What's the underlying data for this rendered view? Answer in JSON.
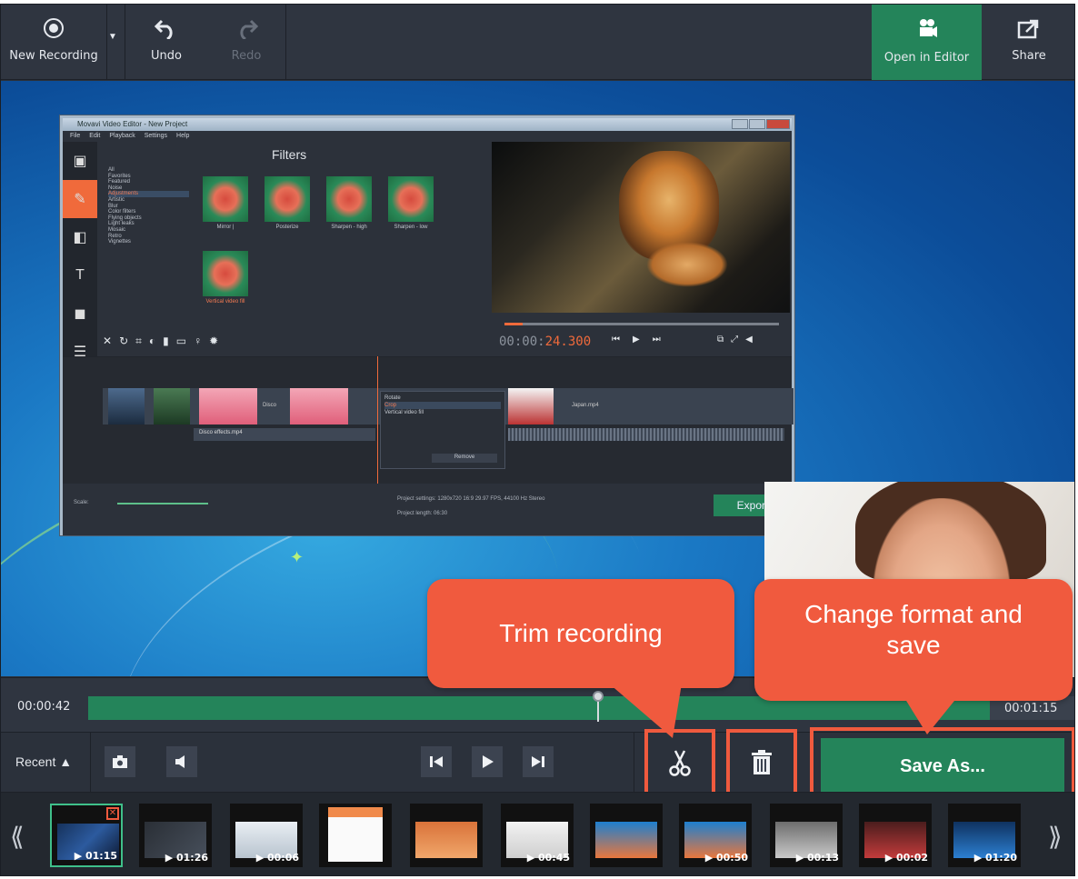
{
  "toolbar": {
    "new_recording": "New Recording",
    "undo": "Undo",
    "redo": "Redo",
    "open_in_editor": "Open in Editor",
    "share": "Share"
  },
  "editor": {
    "title": "Movavi Video Editor - New Project",
    "menu": [
      "File",
      "Edit",
      "Playback",
      "Settings",
      "Help"
    ],
    "filters_title": "Filters",
    "categories": [
      "All",
      "Favorites",
      "Featured",
      "Noise",
      "Adjustments",
      "Artistic",
      "Blur",
      "Color filters",
      "Flying objects",
      "Light leaks",
      "Mosaic",
      "Retro",
      "Vignettes"
    ],
    "selected_category": "Adjustments",
    "filter_thumbs": [
      "Mirror |",
      "Posterize",
      "Sharpen - high",
      "Sharpen - low",
      "Vertical video fill"
    ],
    "timecode_grey": "00:00:",
    "timecode_accent": "24.300",
    "context_menu": [
      "Rotate",
      "Crop",
      "Vertical video fill"
    ],
    "context_selected": "Crop",
    "remove_label": "Remove",
    "clip_label": "Japan.mp4",
    "clip_text": "Disco",
    "audio_clip_label": "Disco effects.mp4",
    "scale_label": "Scale:",
    "project_settings": "Project settings:  1280x720 16:9 29.97 FPS, 44100 Hz Stereo",
    "project_length": "Project length:   06:30",
    "export_label": "Export"
  },
  "timebar": {
    "current": "00:00:42",
    "total": "00:01:15",
    "progress": 0.65
  },
  "controls": {
    "recent_label": "Recent ▲",
    "save_as": "Save As..."
  },
  "filmstrip": {
    "durations": [
      "01:15",
      "01:26",
      "00:06",
      "",
      "",
      "00:45",
      "",
      "00:50",
      "00:13",
      "00:02",
      "01:20"
    ]
  },
  "callouts": {
    "trim": "Trim recording",
    "change_format": "Change format and save"
  },
  "colors": {
    "accent_green": "#24845a",
    "callout": "#f05a3e",
    "toolbar": "#2f3540"
  }
}
